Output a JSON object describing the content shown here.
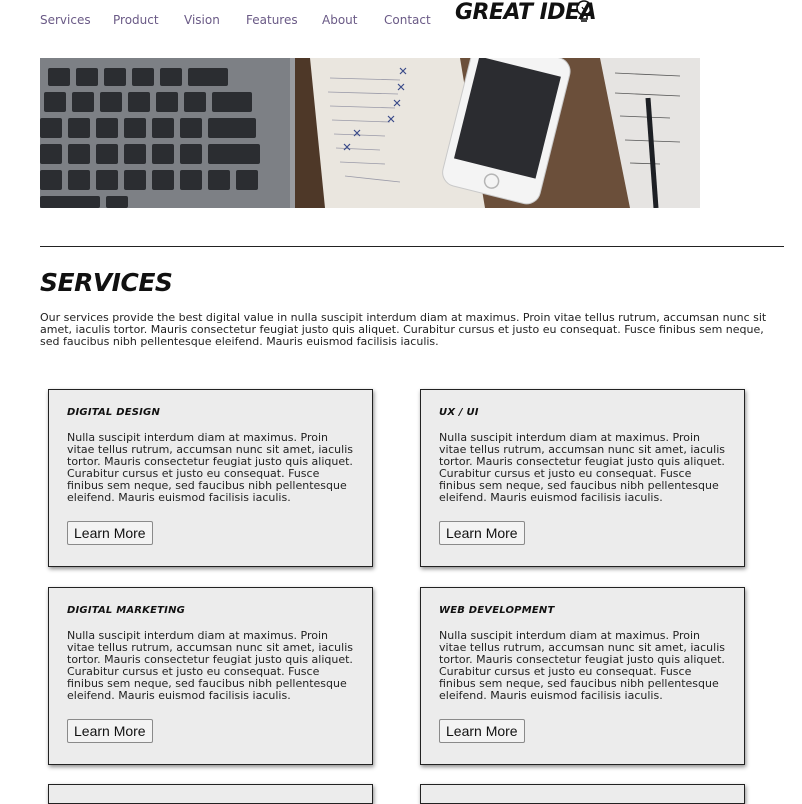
{
  "nav": {
    "items": [
      "Services",
      "Product",
      "Vision",
      "Features",
      "About",
      "Contact"
    ]
  },
  "brand": {
    "logo_text": "GREAT IDEA"
  },
  "hero": {
    "icon": "laptop-notebook-phone-photo"
  },
  "section": {
    "title": "Services",
    "intro": "Our services provide the best digital value in nulla suscipit interdum diam at maximus. Proin vitae tellus rutrum, accumsan nunc sit amet, iaculis tortor. Mauris consectetur feugiat justo quis aliquet. Curabitur cursus et justo eu consequat. Fusce finibus sem neque, sed faucibus nibh pellentesque eleifend. Mauris euismod facilisis iaculis."
  },
  "cards": [
    {
      "title": "Digital Design",
      "body": "Nulla suscipit interdum diam at maximus. Proin vitae tellus rutrum, accumsan nunc sit amet, iaculis tortor. Mauris consectetur feugiat justo quis aliquet. Curabitur cursus et justo eu consequat. Fusce finibus sem neque, sed faucibus nibh pellentesque eleifend. Mauris euismod facilisis iaculis.",
      "button": "Learn More"
    },
    {
      "title": "UX / UI",
      "body": "Nulla suscipit interdum diam at maximus. Proin vitae tellus rutrum, accumsan nunc sit amet, iaculis tortor. Mauris consectetur feugiat justo quis aliquet. Curabitur cursus et justo eu consequat. Fusce finibus sem neque, sed faucibus nibh pellentesque eleifend. Mauris euismod facilisis iaculis.",
      "button": "Learn More"
    },
    {
      "title": "Digital Marketing",
      "body": "Nulla suscipit interdum diam at maximus. Proin vitae tellus rutrum, accumsan nunc sit amet, iaculis tortor. Mauris consectetur feugiat justo quis aliquet. Curabitur cursus et justo eu consequat. Fusce finibus sem neque, sed faucibus nibh pellentesque eleifend. Mauris euismod facilisis iaculis.",
      "button": "Learn More"
    },
    {
      "title": "Web Development",
      "body": "Nulla suscipit interdum diam at maximus. Proin vitae tellus rutrum, accumsan nunc sit amet, iaculis tortor. Mauris consectetur feugiat justo quis aliquet. Curabitur cursus et justo eu consequat. Fusce finibus sem neque, sed faucibus nibh pellentesque eleifend. Mauris euismod facilisis iaculis.",
      "button": "Learn More"
    }
  ]
}
